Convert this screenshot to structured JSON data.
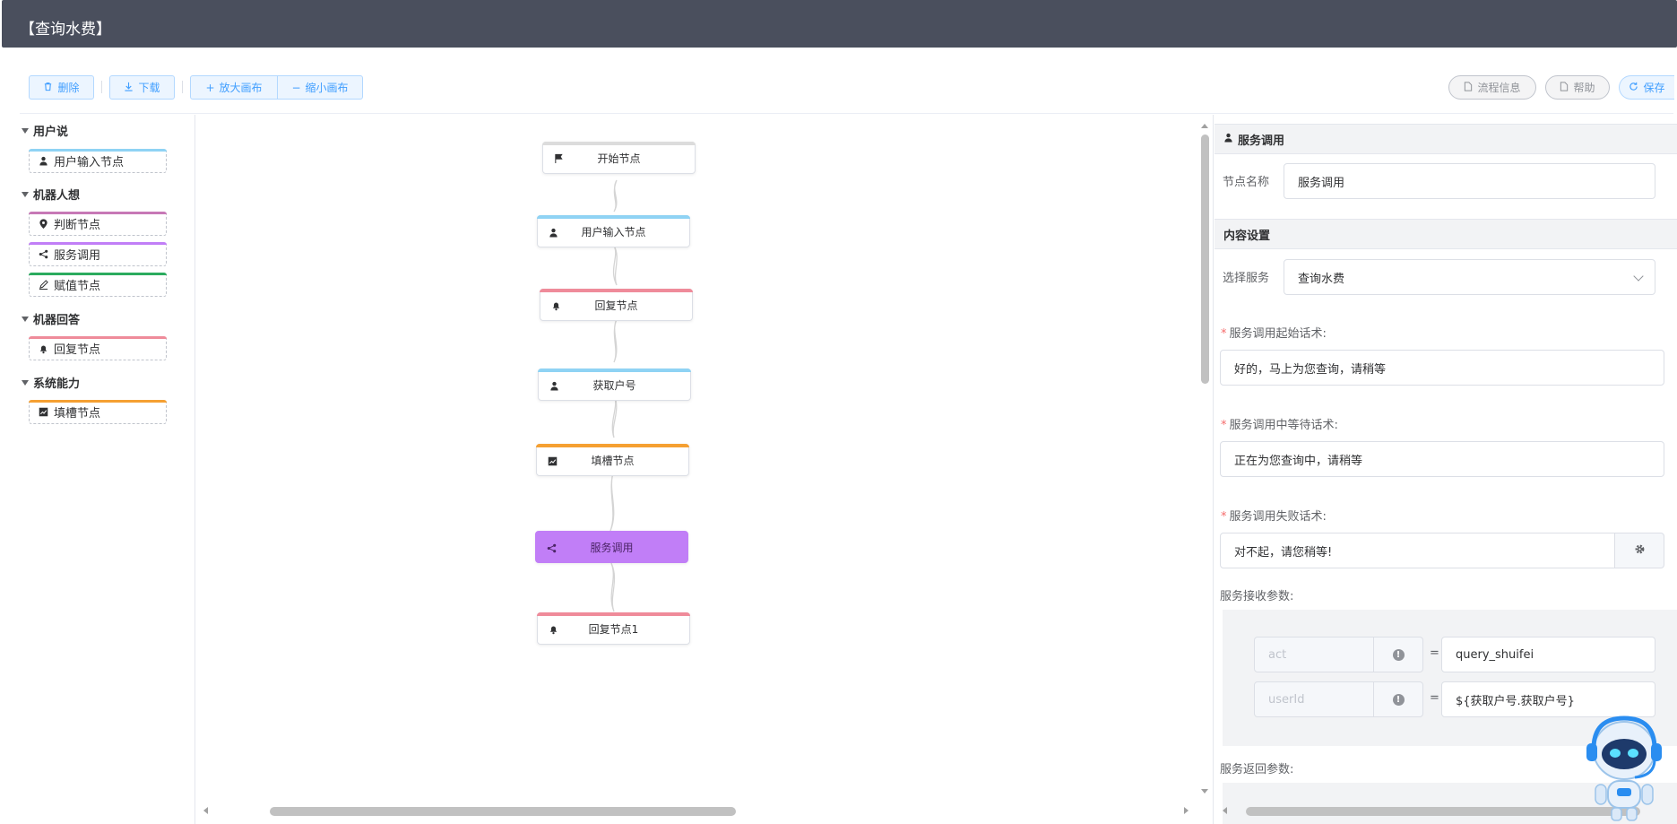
{
  "header": {
    "title": "【查询水费】"
  },
  "toolbar": {
    "delete_label": "删除",
    "download_label": "下载",
    "zoom_in_label": "放大画布",
    "zoom_out_label": "缩小画布",
    "process_info_label": "流程信息",
    "help_label": "帮助",
    "save_label": "保存"
  },
  "palette": {
    "groups": [
      {
        "title": "用户说",
        "items": [
          {
            "label": "用户输入节点",
            "icon": "user-icon",
            "color": "#8fd3f4"
          }
        ]
      },
      {
        "title": "机器人想",
        "items": [
          {
            "label": "判断节点",
            "icon": "location-icon",
            "color": "#c778b6"
          },
          {
            "label": "服务调用",
            "icon": "share-icon",
            "color": "#c17ef7"
          },
          {
            "label": "赋值节点",
            "icon": "edit-icon",
            "color": "#2bab5e"
          }
        ]
      },
      {
        "title": "机器回答",
        "items": [
          {
            "label": "回复节点",
            "icon": "bell-icon",
            "color": "#ef8b9a"
          }
        ]
      },
      {
        "title": "系统能力",
        "items": [
          {
            "label": "填槽节点",
            "icon": "chart-icon",
            "color": "#f5a032"
          }
        ]
      }
    ]
  },
  "flow": {
    "nodes": [
      {
        "label": "开始节点",
        "icon": "flag-icon",
        "color": "#dcdcdc"
      },
      {
        "label": "用户输入节点",
        "icon": "user-icon",
        "color": "#8fd3f4"
      },
      {
        "label": "回复节点",
        "icon": "bell-icon",
        "color": "#ef8b9a"
      },
      {
        "label": "获取户号",
        "icon": "user-icon",
        "color": "#8fd3f4"
      },
      {
        "label": "填槽节点",
        "icon": "chart-icon",
        "color": "#f5a032"
      },
      {
        "label": "服务调用",
        "icon": "share-icon",
        "color": "#c17ef7"
      },
      {
        "label": "回复节点1",
        "icon": "bell-icon",
        "color": "#ef8b9a"
      }
    ]
  },
  "panel": {
    "section_title": "服务调用",
    "node_name_label": "节点名称",
    "node_name_value": "服务调用",
    "content_section_title": "内容设置",
    "select_service_label": "选择服务",
    "select_service_value": "查询水费",
    "start_speech_label": "服务调用起始话术:",
    "start_speech_value": "好的，马上为您查询，请稍等",
    "waiting_speech_label": "服务调用中等待话术:",
    "waiting_speech_value": "正在为您查询中，请稍等",
    "fail_speech_label": "服务调用失败话术:",
    "fail_speech_value": "对不起，请您稍等!",
    "receive_params_label": "服务接收参数:",
    "receive_params": [
      {
        "key": "act",
        "value": "query_shuifei"
      },
      {
        "key": "userId",
        "value": "${获取户号.获取户号}"
      }
    ],
    "return_params_label": "服务返回参数:",
    "equals": "="
  }
}
